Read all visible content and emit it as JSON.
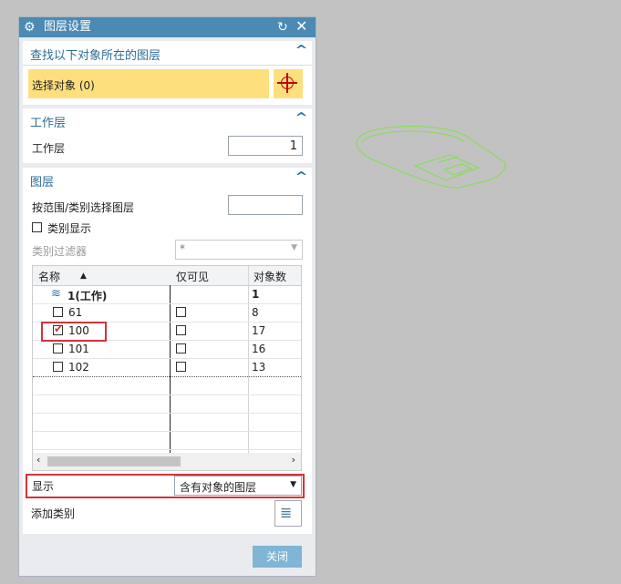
{
  "dialog": {
    "title": "图层设置",
    "icons": {
      "settings": "gear-icon",
      "reset": "reset-icon",
      "close": "close-icon"
    }
  },
  "find_section": {
    "header": "查找以下对象所在的图层",
    "select_label": "选择对象 (0)"
  },
  "work_layer_section": {
    "header": "工作层",
    "label": "工作层",
    "value": "1"
  },
  "layer_section": {
    "header": "图层",
    "range_label": "按范围/类别选择图层",
    "range_value": "",
    "category_display_label": "类别显示",
    "category_filter_label": "类别过滤器",
    "category_filter_value": "*",
    "columns": [
      "名称",
      "仅可见",
      "对象数"
    ],
    "rows": [
      {
        "name": "1(工作)",
        "visible_only": null,
        "count": "1",
        "checked": null,
        "work": true
      },
      {
        "name": "61",
        "visible_only": false,
        "count": "8",
        "checked": false
      },
      {
        "name": "100",
        "visible_only": false,
        "count": "17",
        "checked": true
      },
      {
        "name": "101",
        "visible_only": false,
        "count": "16",
        "checked": false
      },
      {
        "name": "102",
        "visible_only": false,
        "count": "13",
        "checked": false
      }
    ],
    "display_label": "显示",
    "display_value": "含有对象的图层",
    "add_category_label": "添加类别"
  },
  "footer": {
    "close_label": "关闭"
  },
  "colors": {
    "titlebar": "#4a8ab3",
    "section_header": "#2c6e98",
    "selection_bar": "#fedf7e",
    "highlight_box": "#d13438",
    "model_outline": "#7fe04a"
  }
}
